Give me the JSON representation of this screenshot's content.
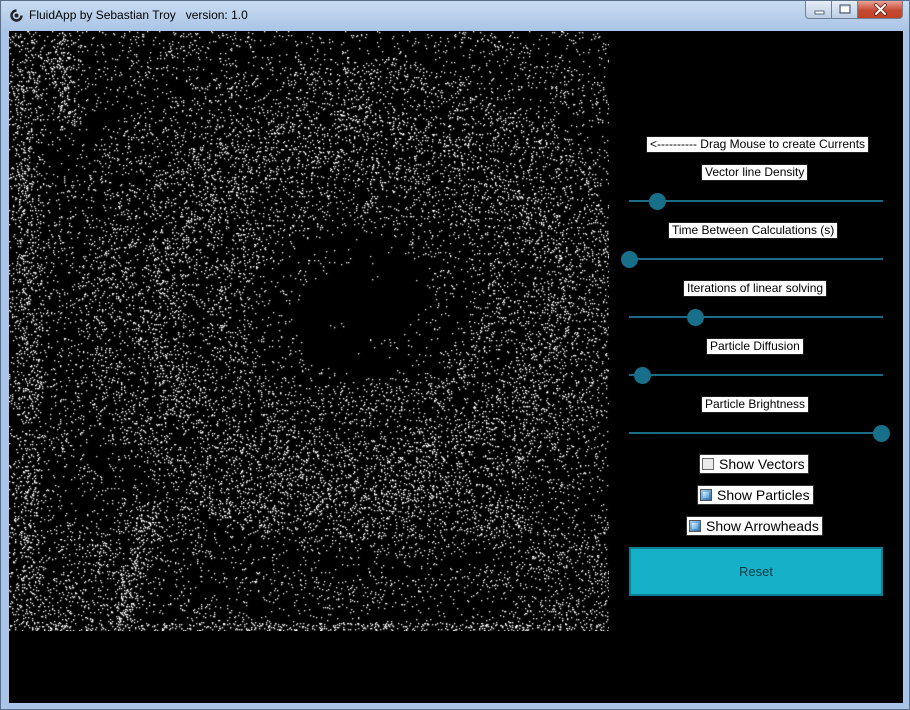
{
  "window": {
    "title": "FluidApp by Sebastian Troy   version: 1.0",
    "controls": {
      "minimize": "minimize-icon",
      "maximize": "maximize-icon",
      "close": "close-icon"
    }
  },
  "canvas": {
    "background": "#000000",
    "particle_color": "#ffffff"
  },
  "panel": {
    "hint": "<---------- Drag Mouse to create Currents",
    "sliders": [
      {
        "label": "Vector line Density",
        "value": 0.11
      },
      {
        "label": "Time Between Calculations (s)",
        "value": 0.0
      },
      {
        "label": "Iterations of linear solving",
        "value": 0.26
      },
      {
        "label": "Particle Diffusion",
        "value": 0.05
      },
      {
        "label": "Particle Brightness",
        "value": 1.0
      }
    ],
    "checkboxes": [
      {
        "label": "Show Vectors",
        "checked": false
      },
      {
        "label": "Show Particles",
        "checked": true
      },
      {
        "label": "Show Arrowheads",
        "checked": true
      }
    ],
    "reset_label": "Reset",
    "accent": "#16b1c8",
    "slider_color": "#176f89"
  }
}
